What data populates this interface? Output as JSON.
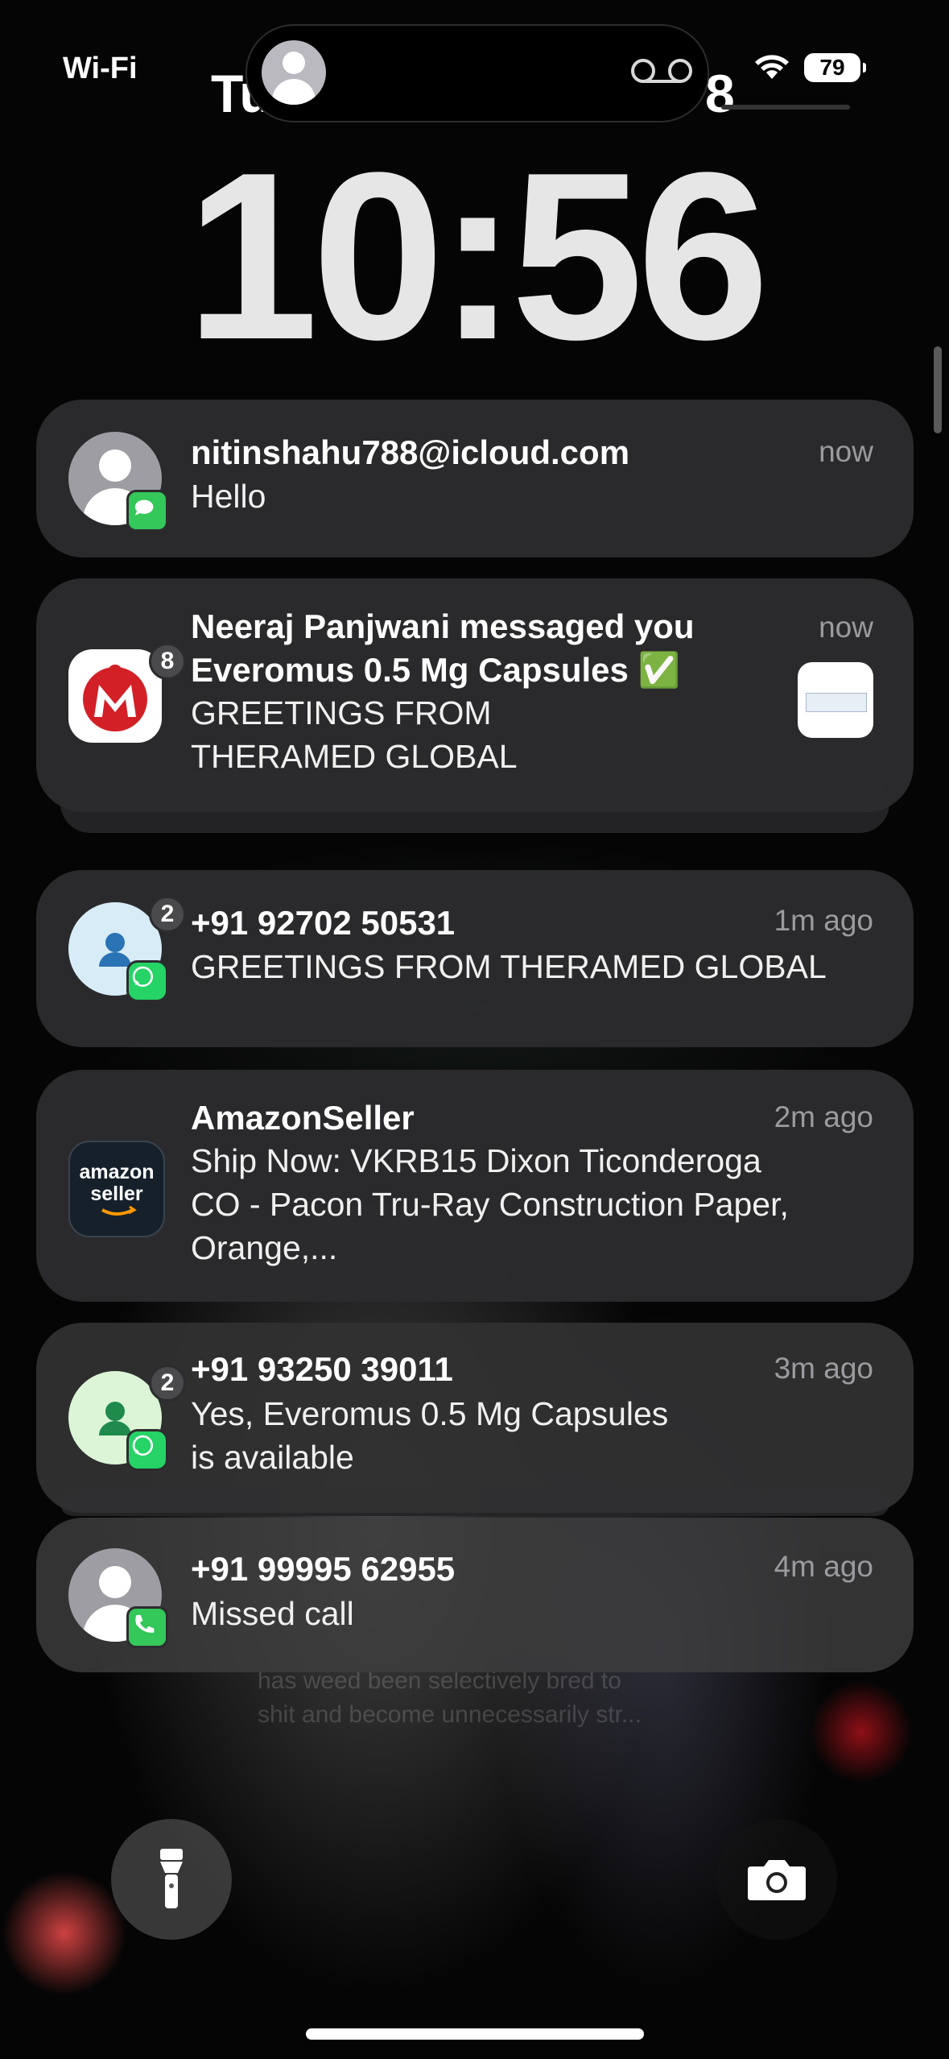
{
  "status_bar": {
    "carrier": "Wi-Fi",
    "date_left": "Tu",
    "date_right": "8",
    "battery": "79",
    "icons": [
      "avatar-icon",
      "voicemail-icon",
      "wifi-icon",
      "battery-icon"
    ]
  },
  "clock": {
    "time": "10:56"
  },
  "notifications": [
    {
      "app": "Messages",
      "icon": "contact-avatar",
      "title": "nitinshahu788@icloud.com",
      "body": [
        "Hello"
      ],
      "time": "now",
      "badge_color": "#34c759"
    },
    {
      "app": "IndiaMART",
      "icon": "indiamart-logo",
      "count": "8",
      "title": "Neeraj Panjwani messaged you",
      "subtitle": "Everomus 0.5 Mg Capsules ✅",
      "body": [
        "GREETINGS FROM",
        "THERAMED GLOBAL"
      ],
      "time": "now",
      "stacked": true
    },
    {
      "app": "WhatsApp",
      "icon": "whatsapp-contact-avatar",
      "count": "2",
      "title": "+91 92702 50531",
      "body": [
        "GREETINGS FROM THERAMED GLOBAL"
      ],
      "time": "1m ago",
      "avatar_bg": "#d7ecf6",
      "badge_color": "#25d366"
    },
    {
      "app": "AmazonSeller",
      "icon": "amazon-seller-logo",
      "logo_text": [
        "amazon",
        "seller"
      ],
      "title": "AmazonSeller",
      "body": [
        "Ship Now:  VKRB15 Dixon Ticonderoga",
        "CO - Pacon Tru-Ray Construction Paper,",
        "Orange,..."
      ],
      "time": "2m ago"
    },
    {
      "app": "WhatsApp",
      "icon": "whatsapp-contact-avatar",
      "count": "2",
      "title": "+91 93250 39011",
      "body": [
        "Yes, Everomus 0.5 Mg Capsules",
        "is available"
      ],
      "time": "3m ago",
      "avatar_bg": "#dbf5d6",
      "badge_color": "#25d366"
    },
    {
      "app": "Phone",
      "icon": "contact-avatar",
      "title": "+91 99995 62955",
      "body": [
        "Missed call"
      ],
      "time": "4m ago",
      "badge_color": "#34c759"
    }
  ],
  "wallpaper": {
    "caption": [
      "has weed been selectively bred to",
      "shit and become unnecessarily str..."
    ]
  },
  "controls": {
    "flashlight": "flashlight-icon",
    "camera": "camera-icon"
  }
}
